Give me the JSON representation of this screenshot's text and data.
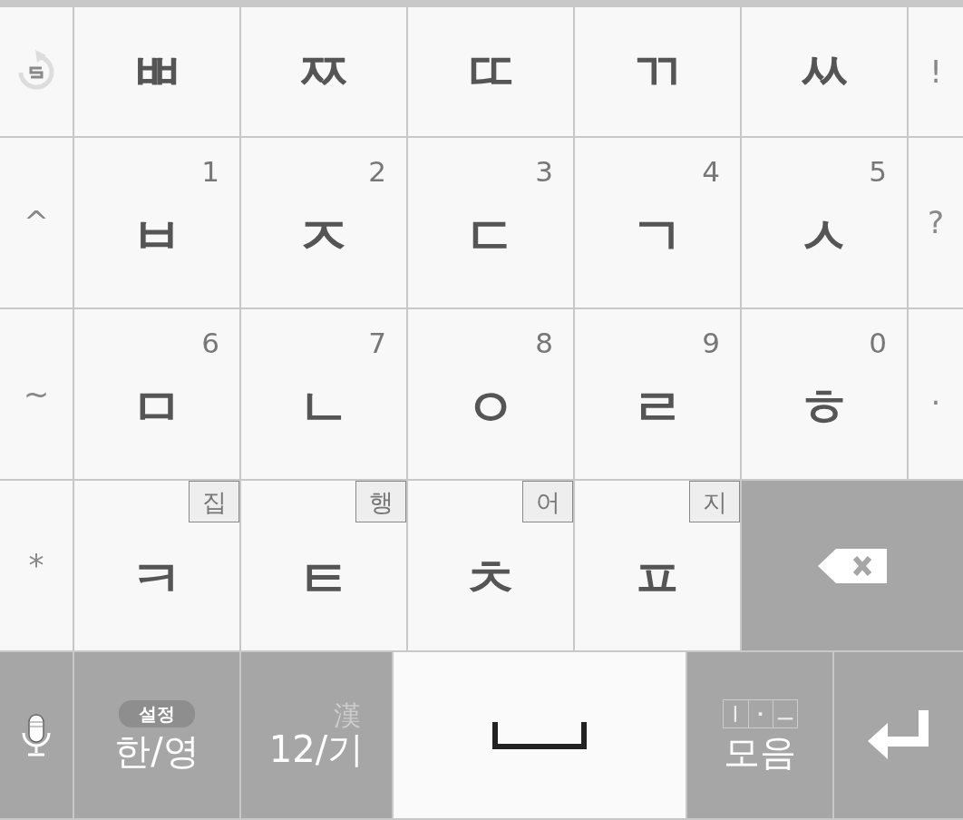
{
  "left_column": [
    "^",
    "~",
    "*"
  ],
  "letter_rows": [
    [
      {
        "label": "ㅃ"
      },
      {
        "label": "ㅉ"
      },
      {
        "label": "ㄸ"
      },
      {
        "label": "ㄲ"
      },
      {
        "label": "ㅆ"
      }
    ],
    [
      {
        "label": "ㅂ",
        "number": "1"
      },
      {
        "label": "ㅈ",
        "number": "2"
      },
      {
        "label": "ㄷ",
        "number": "3"
      },
      {
        "label": "ㄱ",
        "number": "4"
      },
      {
        "label": "ㅅ",
        "number": "5"
      }
    ],
    [
      {
        "label": "ㅁ",
        "number": "6"
      },
      {
        "label": "ㄴ",
        "number": "7"
      },
      {
        "label": "ㅇ",
        "number": "8"
      },
      {
        "label": "ㄹ",
        "number": "9"
      },
      {
        "label": "ㅎ",
        "number": "0"
      }
    ],
    [
      {
        "label": "ㅋ",
        "hint": "집"
      },
      {
        "label": "ㅌ",
        "hint": "행"
      },
      {
        "label": "ㅊ",
        "hint": "어"
      },
      {
        "label": "ㅍ",
        "hint": "지"
      }
    ]
  ],
  "right_column": [
    "!",
    "?",
    "."
  ],
  "bottom_row": [
    {
      "kind": "mic"
    },
    {
      "kind": "lang",
      "badge": "설정",
      "label": "한/영"
    },
    {
      "kind": "symbols",
      "corner": "漢",
      "label": "12/기"
    },
    {
      "kind": "space"
    },
    {
      "kind": "vowel",
      "vowels": [
        "ㅣ",
        "·",
        "ㅡ"
      ],
      "label": "모음"
    },
    {
      "kind": "enter"
    }
  ]
}
